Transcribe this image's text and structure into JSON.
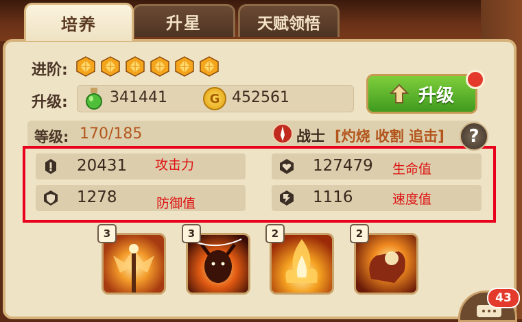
{
  "tabs": [
    {
      "label": "培养"
    },
    {
      "label": "升星"
    },
    {
      "label": "天赋领悟"
    }
  ],
  "advance": {
    "label": "进阶:",
    "gem_count": 6,
    "gem_color": "#f4a51c"
  },
  "upgrade": {
    "label": "升级:",
    "potion_amount": "341441",
    "gold_icon_text": "G",
    "gold_amount": "452561",
    "button_label": "升级",
    "accent": "#5cb52a"
  },
  "level": {
    "label": "等级:",
    "value": "170/185",
    "class_name": "战士",
    "traits": "[灼烧 收割 追击]",
    "help_text": "?"
  },
  "stats": [
    {
      "icon": "attack-icon",
      "value": "20431",
      "name": "攻击力"
    },
    {
      "icon": "health-icon",
      "value": "127479",
      "name": "生命值"
    },
    {
      "icon": "defense-icon",
      "value": "1278",
      "name": "防御值"
    },
    {
      "icon": "speed-icon",
      "value": "1116",
      "name": "速度值"
    }
  ],
  "skills": [
    {
      "level": "3",
      "icon": "staff-wings-icon"
    },
    {
      "level": "3",
      "icon": "demon-fire-icon"
    },
    {
      "level": "2",
      "icon": "flame-pillar-icon"
    },
    {
      "level": "2",
      "icon": "fire-fist-icon"
    }
  ],
  "chat": {
    "badge": "43"
  }
}
